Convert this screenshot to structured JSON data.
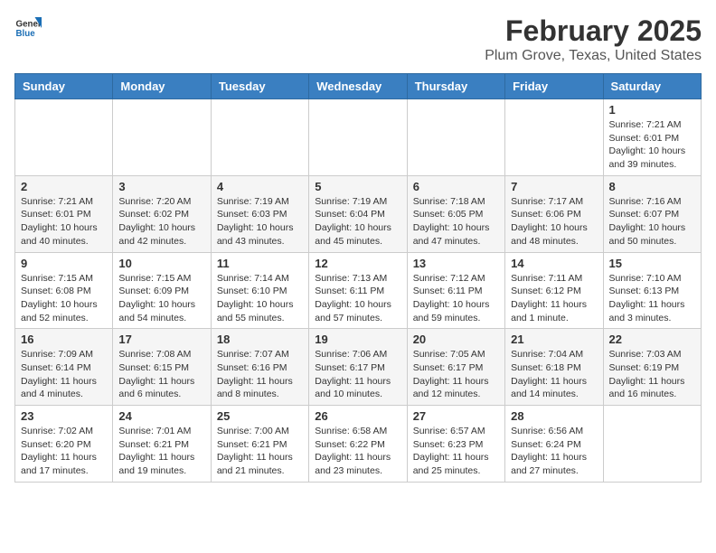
{
  "header": {
    "logo_general": "General",
    "logo_blue": "Blue",
    "title": "February 2025",
    "subtitle": "Plum Grove, Texas, United States"
  },
  "calendar": {
    "days_of_week": [
      "Sunday",
      "Monday",
      "Tuesday",
      "Wednesday",
      "Thursday",
      "Friday",
      "Saturday"
    ],
    "weeks": [
      [
        {
          "day": "",
          "info": ""
        },
        {
          "day": "",
          "info": ""
        },
        {
          "day": "",
          "info": ""
        },
        {
          "day": "",
          "info": ""
        },
        {
          "day": "",
          "info": ""
        },
        {
          "day": "",
          "info": ""
        },
        {
          "day": "1",
          "info": "Sunrise: 7:21 AM\nSunset: 6:01 PM\nDaylight: 10 hours and 39 minutes."
        }
      ],
      [
        {
          "day": "2",
          "info": "Sunrise: 7:21 AM\nSunset: 6:01 PM\nDaylight: 10 hours and 40 minutes."
        },
        {
          "day": "3",
          "info": "Sunrise: 7:20 AM\nSunset: 6:02 PM\nDaylight: 10 hours and 42 minutes."
        },
        {
          "day": "4",
          "info": "Sunrise: 7:19 AM\nSunset: 6:03 PM\nDaylight: 10 hours and 43 minutes."
        },
        {
          "day": "5",
          "info": "Sunrise: 7:19 AM\nSunset: 6:04 PM\nDaylight: 10 hours and 45 minutes."
        },
        {
          "day": "6",
          "info": "Sunrise: 7:18 AM\nSunset: 6:05 PM\nDaylight: 10 hours and 47 minutes."
        },
        {
          "day": "7",
          "info": "Sunrise: 7:17 AM\nSunset: 6:06 PM\nDaylight: 10 hours and 48 minutes."
        },
        {
          "day": "8",
          "info": "Sunrise: 7:16 AM\nSunset: 6:07 PM\nDaylight: 10 hours and 50 minutes."
        }
      ],
      [
        {
          "day": "9",
          "info": "Sunrise: 7:15 AM\nSunset: 6:08 PM\nDaylight: 10 hours and 52 minutes."
        },
        {
          "day": "10",
          "info": "Sunrise: 7:15 AM\nSunset: 6:09 PM\nDaylight: 10 hours and 54 minutes."
        },
        {
          "day": "11",
          "info": "Sunrise: 7:14 AM\nSunset: 6:10 PM\nDaylight: 10 hours and 55 minutes."
        },
        {
          "day": "12",
          "info": "Sunrise: 7:13 AM\nSunset: 6:11 PM\nDaylight: 10 hours and 57 minutes."
        },
        {
          "day": "13",
          "info": "Sunrise: 7:12 AM\nSunset: 6:11 PM\nDaylight: 10 hours and 59 minutes."
        },
        {
          "day": "14",
          "info": "Sunrise: 7:11 AM\nSunset: 6:12 PM\nDaylight: 11 hours and 1 minute."
        },
        {
          "day": "15",
          "info": "Sunrise: 7:10 AM\nSunset: 6:13 PM\nDaylight: 11 hours and 3 minutes."
        }
      ],
      [
        {
          "day": "16",
          "info": "Sunrise: 7:09 AM\nSunset: 6:14 PM\nDaylight: 11 hours and 4 minutes."
        },
        {
          "day": "17",
          "info": "Sunrise: 7:08 AM\nSunset: 6:15 PM\nDaylight: 11 hours and 6 minutes."
        },
        {
          "day": "18",
          "info": "Sunrise: 7:07 AM\nSunset: 6:16 PM\nDaylight: 11 hours and 8 minutes."
        },
        {
          "day": "19",
          "info": "Sunrise: 7:06 AM\nSunset: 6:17 PM\nDaylight: 11 hours and 10 minutes."
        },
        {
          "day": "20",
          "info": "Sunrise: 7:05 AM\nSunset: 6:17 PM\nDaylight: 11 hours and 12 minutes."
        },
        {
          "day": "21",
          "info": "Sunrise: 7:04 AM\nSunset: 6:18 PM\nDaylight: 11 hours and 14 minutes."
        },
        {
          "day": "22",
          "info": "Sunrise: 7:03 AM\nSunset: 6:19 PM\nDaylight: 11 hours and 16 minutes."
        }
      ],
      [
        {
          "day": "23",
          "info": "Sunrise: 7:02 AM\nSunset: 6:20 PM\nDaylight: 11 hours and 17 minutes."
        },
        {
          "day": "24",
          "info": "Sunrise: 7:01 AM\nSunset: 6:21 PM\nDaylight: 11 hours and 19 minutes."
        },
        {
          "day": "25",
          "info": "Sunrise: 7:00 AM\nSunset: 6:21 PM\nDaylight: 11 hours and 21 minutes."
        },
        {
          "day": "26",
          "info": "Sunrise: 6:58 AM\nSunset: 6:22 PM\nDaylight: 11 hours and 23 minutes."
        },
        {
          "day": "27",
          "info": "Sunrise: 6:57 AM\nSunset: 6:23 PM\nDaylight: 11 hours and 25 minutes."
        },
        {
          "day": "28",
          "info": "Sunrise: 6:56 AM\nSunset: 6:24 PM\nDaylight: 11 hours and 27 minutes."
        },
        {
          "day": "",
          "info": ""
        }
      ]
    ]
  }
}
